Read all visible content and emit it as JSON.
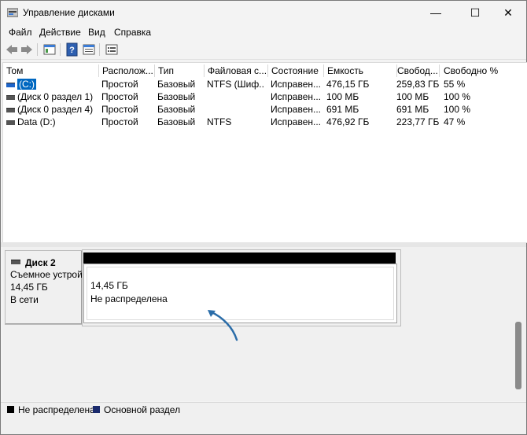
{
  "window": {
    "title": "Управление дисками",
    "buttons": {
      "minimize": "—",
      "maximize": "☐",
      "close": "✕"
    }
  },
  "menu": [
    "Файл",
    "Действие",
    "Вид",
    "Справка"
  ],
  "table": {
    "columns": [
      "Том",
      "Располож...",
      "Тип",
      "Файловая с...",
      "Состояние",
      "Емкость",
      "Свобод...",
      "Свободно %"
    ],
    "rows": [
      [
        "(C:)",
        "Простой",
        "Базовый",
        "NTFS (Шиф...",
        "Исправен...",
        "476,15 ГБ",
        "259,83 ГБ",
        "55 %"
      ],
      [
        "(Диск 0 раздел 1)",
        "Простой",
        "Базовый",
        "",
        "Исправен...",
        "100 МБ",
        "100 МБ",
        "100 %"
      ],
      [
        "(Диск 0 раздел 4)",
        "Простой",
        "Базовый",
        "",
        "Исправен...",
        "691 МБ",
        "691 МБ",
        "100 %"
      ],
      [
        "Data (D:)",
        "Простой",
        "Базовый",
        "NTFS",
        "Исправен...",
        "476,92 ГБ",
        "223,77 ГБ",
        "47 %"
      ]
    ]
  },
  "disk": {
    "name": "Диск 2",
    "type": "Съемное устрой",
    "size": "14,45 ГБ",
    "status": "В сети",
    "partition": {
      "size": "14,45 ГБ",
      "label": "Не распределена"
    }
  },
  "legend": [
    {
      "label": "Не распределена",
      "color": "#000000"
    },
    {
      "label": "Основной раздел",
      "color": "#1a2a6c"
    }
  ],
  "colors": {
    "selection": "#0067c0",
    "arrow": "#2a6ca8"
  }
}
